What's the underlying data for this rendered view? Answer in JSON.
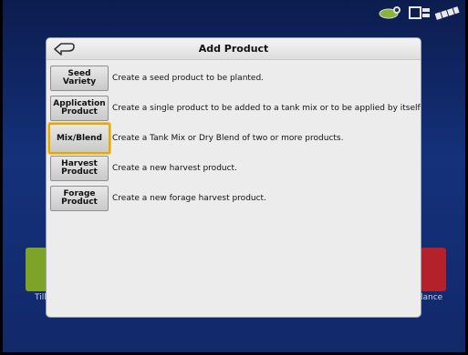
{
  "header": {
    "title": "Add Product",
    "back_icon": "back-arrow-icon"
  },
  "status_icons": [
    "tractor-gps-icon",
    "display-icon",
    "signal-chain-icon"
  ],
  "background": {
    "left_tile_label": "Tilla",
    "right_tile_label": "lance"
  },
  "products": [
    {
      "label": "Seed\nVariety",
      "description": "Create a seed product to be planted.",
      "selected": false
    },
    {
      "label": "Application\nProduct",
      "description": "Create a single product to be added to a tank mix or to be applied by itself.",
      "selected": false
    },
    {
      "label": "Mix/Blend",
      "description": "Create a Tank Mix or Dry Blend of two or more products.",
      "selected": true
    },
    {
      "label": "Harvest\nProduct",
      "description": "Create a new harvest product.",
      "selected": false
    },
    {
      "label": "Forage\nProduct",
      "description": "Create a new forage harvest product.",
      "selected": false
    }
  ],
  "colors": {
    "selection": "#e1a90f",
    "background": "#14317a",
    "dialog": "#ececec"
  }
}
